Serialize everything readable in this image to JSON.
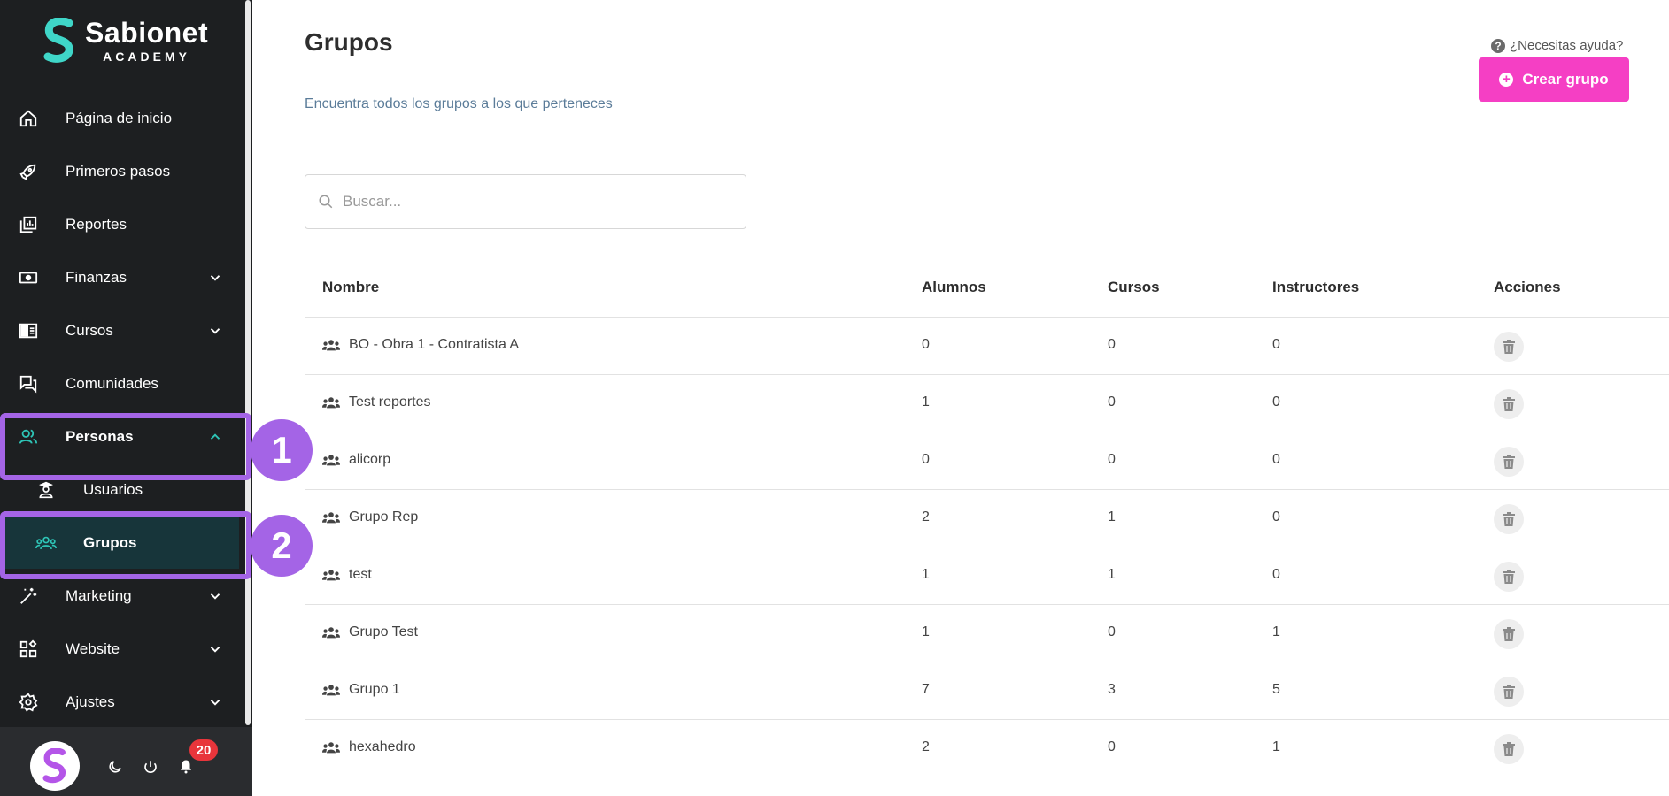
{
  "brand": {
    "name": "Sabionet",
    "sub": "ACADEMY"
  },
  "sidebar": {
    "items": [
      {
        "label": "Página de inicio",
        "icon": "home-icon"
      },
      {
        "label": "Primeros pasos",
        "icon": "rocket-icon"
      },
      {
        "label": "Reportes",
        "icon": "reports-icon"
      },
      {
        "label": "Finanzas",
        "icon": "money-icon"
      },
      {
        "label": "Cursos",
        "icon": "courses-icon"
      },
      {
        "label": "Comunidades",
        "icon": "chat-icon"
      },
      {
        "label": "Personas",
        "icon": "people-icon"
      },
      {
        "label": "Marketing",
        "icon": "magic-wand-icon"
      },
      {
        "label": "Website",
        "icon": "widgets-icon"
      },
      {
        "label": "Ajustes",
        "icon": "gear-icon"
      }
    ],
    "subitems": [
      {
        "label": "Usuarios",
        "icon": "user-graduate-icon"
      },
      {
        "label": "Grupos",
        "icon": "group-icon"
      }
    ],
    "notifications_count": "20"
  },
  "annotations": {
    "step1": "1",
    "step2": "2"
  },
  "header": {
    "title": "Grupos",
    "subtitle": "Encuentra todos los grupos a los que perteneces",
    "help": "¿Necesitas ayuda?",
    "create_label": "Crear grupo"
  },
  "search": {
    "placeholder": "Buscar..."
  },
  "table": {
    "columns": [
      "Nombre",
      "Alumnos",
      "Cursos",
      "Instructores",
      "Acciones"
    ],
    "rows": [
      {
        "name": "BO - Obra 1 - Contratista A",
        "alumnos": "0",
        "cursos": "0",
        "instructores": "0"
      },
      {
        "name": "Test reportes",
        "alumnos": "1",
        "cursos": "0",
        "instructores": "0"
      },
      {
        "name": "alicorp",
        "alumnos": "0",
        "cursos": "0",
        "instructores": "0"
      },
      {
        "name": "Grupo Rep",
        "alumnos": "2",
        "cursos": "1",
        "instructores": "0"
      },
      {
        "name": "test",
        "alumnos": "1",
        "cursos": "1",
        "instructores": "0"
      },
      {
        "name": "Grupo Test",
        "alumnos": "1",
        "cursos": "0",
        "instructores": "1"
      },
      {
        "name": "Grupo 1",
        "alumnos": "7",
        "cursos": "3",
        "instructores": "5"
      },
      {
        "name": "hexahedro",
        "alumnos": "2",
        "cursos": "0",
        "instructores": "1"
      }
    ]
  },
  "colors": {
    "accent": "#f53fc4",
    "teal": "#2ec4b6",
    "highlight": "#a464e6",
    "sidebar_bg": "#1d1f21"
  }
}
